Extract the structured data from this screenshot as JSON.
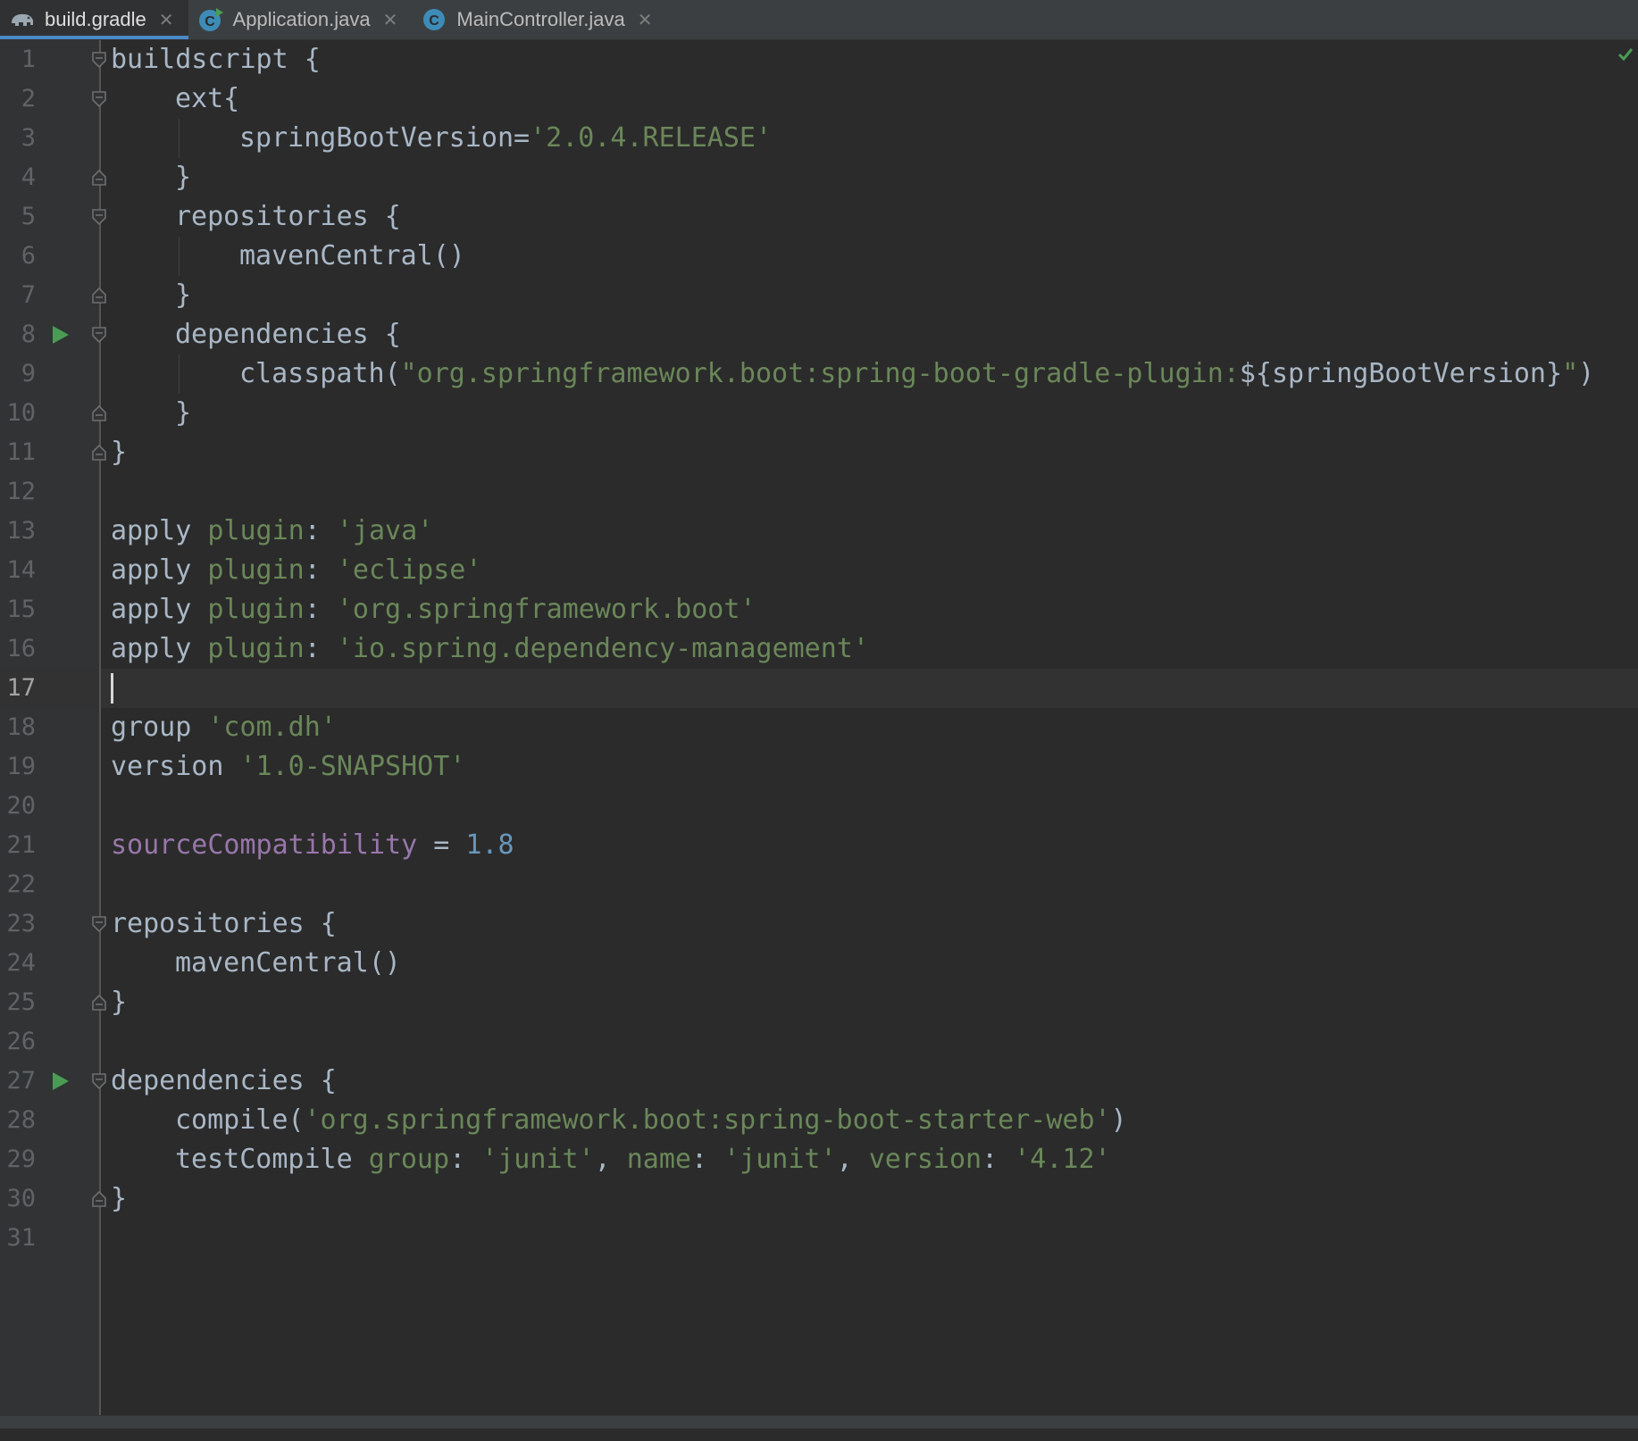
{
  "tabs": [
    {
      "label": "build.gradle",
      "icon": "gradle-elephant-icon",
      "active": true
    },
    {
      "label": "Application.java",
      "icon": "java-class-run-icon",
      "active": false
    },
    {
      "label": "MainController.java",
      "icon": "java-class-icon",
      "active": false
    }
  ],
  "editor": {
    "current_line": 17,
    "lines": [
      {
        "n": "1",
        "fold": "open",
        "indent": 0,
        "tokens": [
          [
            "buildscript {",
            "plain"
          ]
        ]
      },
      {
        "n": "2",
        "fold": "open",
        "indent": 1,
        "tokens": [
          [
            "ext{",
            "plain"
          ]
        ]
      },
      {
        "n": "3",
        "fold": "",
        "indent": 2,
        "tokens": [
          [
            "springBootVersion=",
            "plain"
          ],
          [
            "'2.0.4.RELEASE'",
            "str"
          ]
        ]
      },
      {
        "n": "4",
        "fold": "close",
        "indent": 1,
        "tokens": [
          [
            "}",
            "plain"
          ]
        ]
      },
      {
        "n": "5",
        "fold": "open",
        "indent": 1,
        "tokens": [
          [
            "repositories {",
            "plain"
          ]
        ]
      },
      {
        "n": "6",
        "fold": "",
        "indent": 2,
        "tokens": [
          [
            "mavenCentral()",
            "plain"
          ]
        ]
      },
      {
        "n": "7",
        "fold": "close",
        "indent": 1,
        "tokens": [
          [
            "}",
            "plain"
          ]
        ]
      },
      {
        "n": "8",
        "fold": "open",
        "indent": 1,
        "run": true,
        "tokens": [
          [
            "dependencies {",
            "plain"
          ]
        ]
      },
      {
        "n": "9",
        "fold": "",
        "indent": 2,
        "tokens": [
          [
            "classpath(",
            "plain"
          ],
          [
            "\"org.springframework.boot:spring-boot-gradle-plugin:",
            "str"
          ],
          [
            "${springBootVersion}",
            "plain"
          ],
          [
            "\"",
            "str"
          ],
          [
            ")",
            "plain"
          ]
        ]
      },
      {
        "n": "10",
        "fold": "close",
        "indent": 1,
        "tokens": [
          [
            "}",
            "plain"
          ]
        ]
      },
      {
        "n": "11",
        "fold": "close",
        "indent": 0,
        "tokens": [
          [
            "}",
            "plain"
          ]
        ]
      },
      {
        "n": "12",
        "fold": "",
        "indent": 0,
        "tokens": []
      },
      {
        "n": "13",
        "fold": "",
        "indent": 0,
        "tokens": [
          [
            "apply ",
            "plain"
          ],
          [
            "plugin",
            "named"
          ],
          [
            ": ",
            "plain"
          ],
          [
            "'java'",
            "str"
          ]
        ]
      },
      {
        "n": "14",
        "fold": "",
        "indent": 0,
        "tokens": [
          [
            "apply ",
            "plain"
          ],
          [
            "plugin",
            "named"
          ],
          [
            ": ",
            "plain"
          ],
          [
            "'eclipse'",
            "str"
          ]
        ]
      },
      {
        "n": "15",
        "fold": "",
        "indent": 0,
        "tokens": [
          [
            "apply ",
            "plain"
          ],
          [
            "plugin",
            "named"
          ],
          [
            ": ",
            "plain"
          ],
          [
            "'org.springframework.boot'",
            "str"
          ]
        ]
      },
      {
        "n": "16",
        "fold": "",
        "indent": 0,
        "tokens": [
          [
            "apply ",
            "plain"
          ],
          [
            "plugin",
            "named"
          ],
          [
            ": ",
            "plain"
          ],
          [
            "'io.spring.dependency-management'",
            "str"
          ]
        ]
      },
      {
        "n": "17",
        "fold": "",
        "indent": 0,
        "tokens": []
      },
      {
        "n": "18",
        "fold": "",
        "indent": 0,
        "tokens": [
          [
            "group ",
            "plain"
          ],
          [
            "'com.dh'",
            "str"
          ]
        ]
      },
      {
        "n": "19",
        "fold": "",
        "indent": 0,
        "tokens": [
          [
            "version ",
            "plain"
          ],
          [
            "'1.0-SNAPSHOT'",
            "str"
          ]
        ]
      },
      {
        "n": "20",
        "fold": "",
        "indent": 0,
        "tokens": []
      },
      {
        "n": "21",
        "fold": "",
        "indent": 0,
        "tokens": [
          [
            "sourceCompatibility",
            "prop"
          ],
          [
            " = ",
            "plain"
          ],
          [
            "1.8",
            "num"
          ]
        ]
      },
      {
        "n": "22",
        "fold": "",
        "indent": 0,
        "tokens": []
      },
      {
        "n": "23",
        "fold": "open",
        "indent": 0,
        "tokens": [
          [
            "repositories {",
            "plain"
          ]
        ]
      },
      {
        "n": "24",
        "fold": "",
        "indent": 1,
        "tokens": [
          [
            "mavenCentral()",
            "plain"
          ]
        ]
      },
      {
        "n": "25",
        "fold": "close",
        "indent": 0,
        "tokens": [
          [
            "}",
            "plain"
          ]
        ]
      },
      {
        "n": "26",
        "fold": "",
        "indent": 0,
        "tokens": []
      },
      {
        "n": "27",
        "fold": "open",
        "indent": 0,
        "run": true,
        "tokens": [
          [
            "dependencies {",
            "plain"
          ]
        ]
      },
      {
        "n": "28",
        "fold": "",
        "indent": 1,
        "tokens": [
          [
            "compile(",
            "plain"
          ],
          [
            "'org.springframework.boot:spring-boot-starter-web'",
            "str"
          ],
          [
            ")",
            "plain"
          ]
        ]
      },
      {
        "n": "29",
        "fold": "",
        "indent": 1,
        "tokens": [
          [
            "testCompile ",
            "plain"
          ],
          [
            "group",
            "named"
          ],
          [
            ": ",
            "plain"
          ],
          [
            "'junit'",
            "str"
          ],
          [
            ", ",
            "plain"
          ],
          [
            "name",
            "named"
          ],
          [
            ": ",
            "plain"
          ],
          [
            "'junit'",
            "str"
          ],
          [
            ", ",
            "plain"
          ],
          [
            "version",
            "named"
          ],
          [
            ": ",
            "plain"
          ],
          [
            "'4.12'",
            "str"
          ]
        ]
      },
      {
        "n": "30",
        "fold": "close",
        "indent": 0,
        "tokens": [
          [
            "}",
            "plain"
          ]
        ]
      },
      {
        "n": "31",
        "fold": "",
        "indent": 0,
        "tokens": []
      }
    ]
  },
  "colors": {
    "background": "#2b2b2b",
    "gutter": "#313335",
    "plain": "#a9b7c6",
    "string": "#6a8759",
    "number": "#6897bb",
    "property": "#9876aa",
    "run_icon": "#499c54",
    "active_tab_underline": "#4a88c7"
  }
}
